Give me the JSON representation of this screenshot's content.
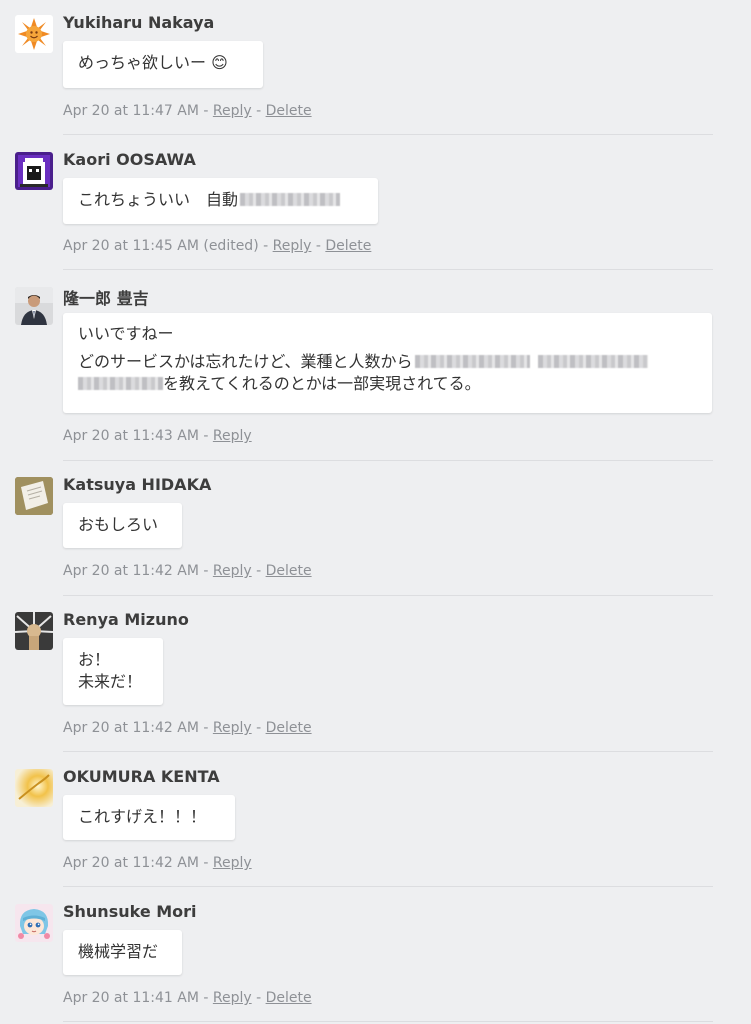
{
  "comments": [
    {
      "author": "Yukiharu Nakaya",
      "body": [
        "めっちゃ欲しいー 😊"
      ],
      "time": "Apr 20 at 11:47 AM",
      "reply": "Reply",
      "delete": "Delete"
    },
    {
      "author": "Kaori OOSAWA",
      "body": [
        "これちょういい　自動"
      ],
      "time": "Apr 20 at 11:45 AM (edited)",
      "reply": "Reply",
      "delete": "Delete"
    },
    {
      "author": "隆一郎 豊吉",
      "body": [
        "いいですねー",
        "どのサービスかは忘れたけど、業種と人数から",
        "を教えてくれるのとかは一部実現されてる。"
      ],
      "time": "Apr 20 at 11:43 AM",
      "reply": "Reply"
    },
    {
      "author": "Katsuya HIDAKA",
      "body": [
        "おもしろい"
      ],
      "time": "Apr 20 at 11:42 AM",
      "reply": "Reply",
      "delete": "Delete"
    },
    {
      "author": "Renya Mizuno",
      "body": [
        "お！",
        "未来だ！"
      ],
      "time": "Apr 20 at 11:42 AM",
      "reply": "Reply",
      "delete": "Delete"
    },
    {
      "author": "OKUMURA KENTA",
      "body": [
        "これすげえ！！！"
      ],
      "time": "Apr 20 at 11:42 AM",
      "reply": "Reply"
    },
    {
      "author": "Shunsuke Mori",
      "body": [
        "機械学習だ"
      ],
      "time": "Apr 20 at 11:41 AM",
      "reply": "Reply",
      "delete": "Delete"
    }
  ],
  "separator": " - ",
  "colors": {
    "background": "#eeeff1",
    "author": "#3d3d3d",
    "meta": "#8e9196",
    "bubble": "#ffffff"
  },
  "avatars": [
    "sun-avatar-icon",
    "pixel-character-avatar-icon",
    "person-photo-avatar-icon",
    "document-photo-avatar-icon",
    "spiky-character-avatar-icon",
    "burst-avatar-icon",
    "anime-girl-avatar-icon"
  ]
}
